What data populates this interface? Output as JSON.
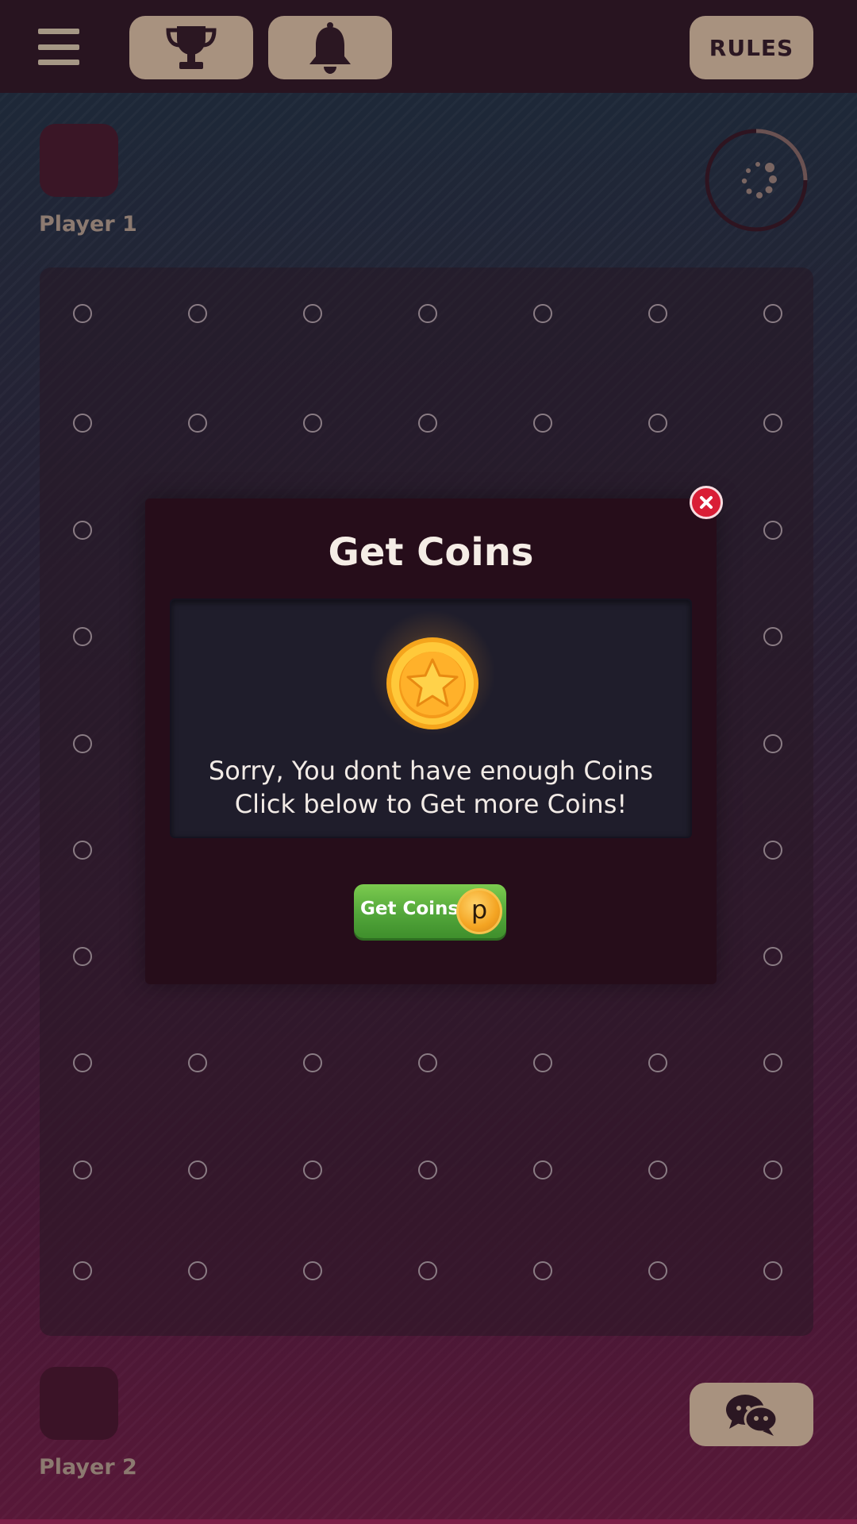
{
  "header": {
    "rules_label": "RULES"
  },
  "players": {
    "player1_name": "Player 1",
    "player2_name": "Player 2"
  },
  "board": {
    "columns": 7,
    "rows": 10
  },
  "modal": {
    "title": "Get Coins",
    "message_line1": "Sorry, You dont have enough Coins",
    "message_line2": "Click below to Get more Coins!",
    "button_label": "Get Coins",
    "button_coin_letter": "p"
  },
  "colors": {
    "topbar": "#281420",
    "button_tan": "#a8927f",
    "modal_bg": "#260d1a",
    "accent_green": "#52a63a",
    "close_red": "#d91e36",
    "coin_gold": "#f4a422"
  },
  "icons": {
    "menu": "hamburger-icon",
    "trophy": "trophy-icon",
    "bell": "bell-icon",
    "timer": "loading-spinner-icon",
    "chat": "chat-bubbles-icon",
    "close": "close-icon",
    "coin": "star-coin-icon"
  }
}
